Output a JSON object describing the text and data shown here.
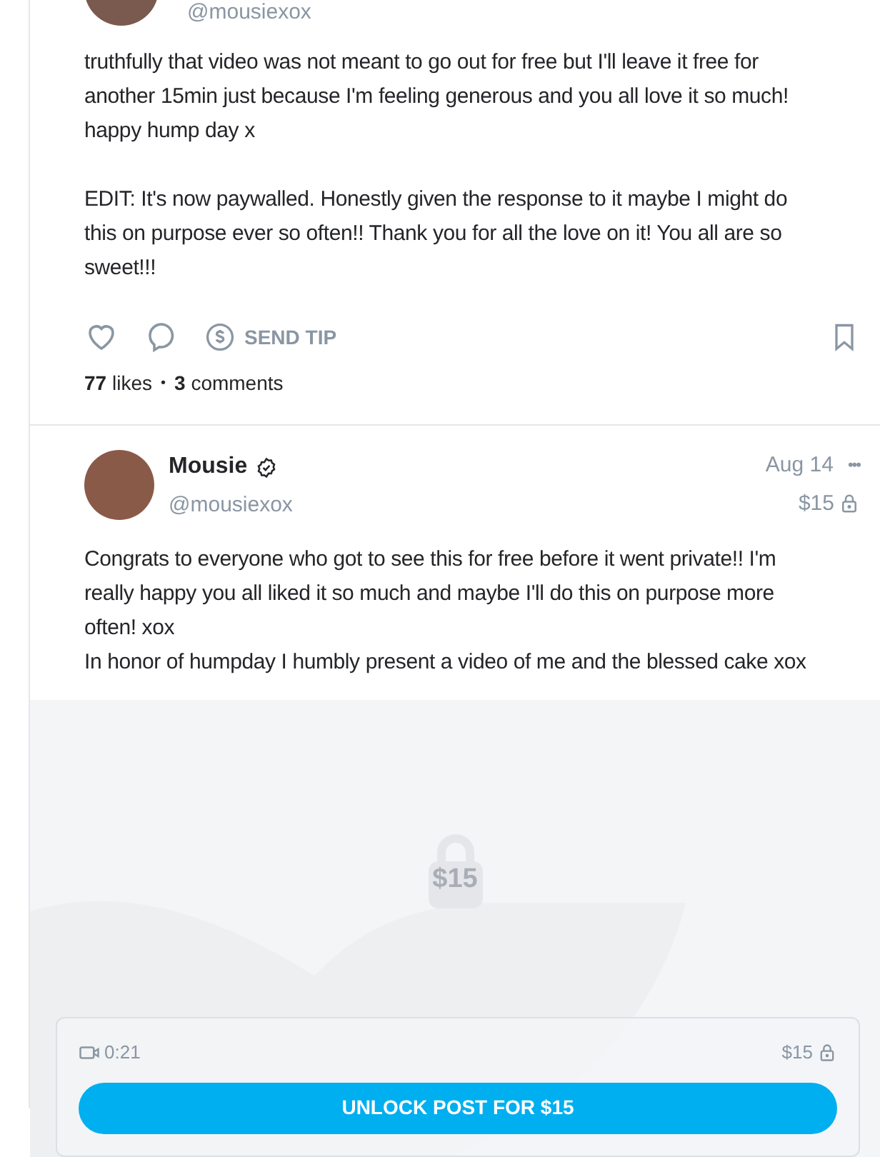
{
  "posts": [
    {
      "author": {
        "handle": "@mousiexox"
      },
      "paragraphs": [
        {
          "text": "truthfully that video was not meant to go out for free but I'll leave it free for another 15min just because I'm feeling generous and you all love it so much! happy hump day x",
          "gap_after": true
        },
        {
          "text": "EDIT: It's now paywalled. Honestly given the response to it maybe I might do this on purpose ever so often!! Thank you for all the love on it! You all are so sweet!!!",
          "gap_after": false
        }
      ],
      "actions": {
        "liked": false,
        "bookmarked": false,
        "tip_label": "SEND TIP"
      },
      "stats": {
        "likes_count": "77",
        "likes_label": "likes",
        "separator": "•",
        "comments_count": "3",
        "comments_label": "comments"
      }
    },
    {
      "author": {
        "name": "Mousie",
        "verified": true,
        "handle": "@mousiexox"
      },
      "date": "Aug 14",
      "more": "•••",
      "price": "$15",
      "paragraphs": [
        {
          "text": "Congrats to everyone who got to see this for free before it went private!! I'm really happy you all liked it so much and maybe I'll do this on purpose more often! xox",
          "gap_after": false
        },
        {
          "text": "In honor of humpday I humbly present a video of me and the blessed cake xox",
          "gap_after": false
        }
      ],
      "locked_media": {
        "overlay_price": "$15",
        "duration": "0:21",
        "price": "$15",
        "unlock_label": "UNLOCK POST FOR $15"
      }
    }
  ]
}
